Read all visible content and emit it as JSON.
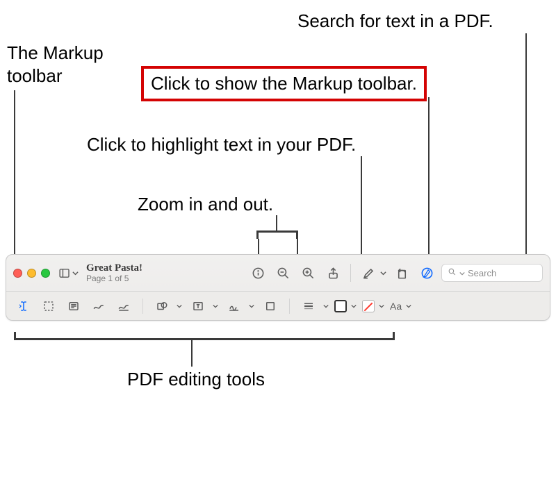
{
  "annotations": {
    "markup_toolbar_label": "The Markup\ntoolbar",
    "search_label": "Search for text in a PDF.",
    "show_markup_label": "Click to show the Markup toolbar.",
    "highlight_label": "Click to highlight text in your PDF.",
    "zoom_label": "Zoom in and out.",
    "editing_tools_label": "PDF editing tools"
  },
  "toolbar": {
    "title": "Great Pasta!",
    "subtitle": "Page 1 of 5",
    "search_placeholder": "Search"
  },
  "colors": {
    "highlight_red": "#d40303",
    "active_blue": "#0a66ff"
  }
}
